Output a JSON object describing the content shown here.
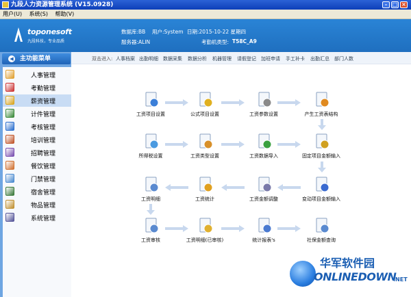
{
  "window": {
    "title": "九段人力资源管理系统 (V15.0928)"
  },
  "menu": [
    "用户(U)",
    "系统(S)",
    "帮助(V)"
  ],
  "header": {
    "logo_text": "toponesoft",
    "logo_slogan": "九段科技，专业品质",
    "database": "数据库:BB",
    "user": "用户:System",
    "date": "日期:2015-10-22 星期四",
    "server": "服务器:ALIN",
    "device_type": "考勤机类型:",
    "device_model": "T58C_A9"
  },
  "sidebar": {
    "title": "主功能菜单",
    "items": [
      {
        "label": "人事管理",
        "icon": "people-icon",
        "color": "#e0a030"
      },
      {
        "label": "考勤管理",
        "icon": "clock-icon",
        "color": "#cc3333"
      },
      {
        "label": "薪资管理",
        "icon": "money-icon",
        "color": "#d9a520"
      },
      {
        "label": "计件管理",
        "icon": "piece-icon",
        "color": "#3a8a3a"
      },
      {
        "label": "考核管理",
        "icon": "check-icon",
        "color": "#2b6fcf"
      },
      {
        "label": "培训管理",
        "icon": "training-icon",
        "color": "#c0552a"
      },
      {
        "label": "招聘管理",
        "icon": "recruit-icon",
        "color": "#7a4fb0"
      },
      {
        "label": "餐饮管理",
        "icon": "dining-icon",
        "color": "#d07030"
      },
      {
        "label": "门禁管理",
        "icon": "door-icon",
        "color": "#4a8ad0"
      },
      {
        "label": "宿舍管理",
        "icon": "dorm-icon",
        "color": "#3a7a3a"
      },
      {
        "label": "物品管理",
        "icon": "goods-icon",
        "color": "#c09030"
      },
      {
        "label": "系统管理",
        "icon": "system-icon",
        "color": "#555599"
      }
    ],
    "active_index": 2
  },
  "shortcuts": {
    "prefix": "双击进入:",
    "items": [
      "人事档案",
      "出勤明细",
      "数据采集",
      "数据分析",
      "机器管理",
      "请假登记",
      "加班申请",
      "手工补卡",
      "出勤汇总",
      "部门人数"
    ]
  },
  "flow": {
    "nodes": [
      {
        "label": "工资项目设置",
        "icon": "abc-book-icon",
        "color": "#3b7fd8"
      },
      {
        "label": "公式项目设置",
        "icon": "pencil-note-icon",
        "color": "#e0b020"
      },
      {
        "label": "工资参数设置",
        "icon": "tools-icon",
        "color": "#8a8a8a"
      },
      {
        "label": "产生工资表结构",
        "icon": "structure-icon",
        "color": "#e08a20"
      },
      {
        "label": "所得税设置",
        "icon": "folder-icon",
        "color": "#4a9ae0"
      },
      {
        "label": "工资类型设置",
        "icon": "person-card-icon",
        "color": "#d8902a"
      },
      {
        "label": "工资数据导入",
        "icon": "disc-import-icon",
        "color": "#3aa040"
      },
      {
        "label": "固定项目金额输入",
        "icon": "pen-doc-icon",
        "color": "#d0a020"
      },
      {
        "label": "工资明细",
        "icon": "doc-search-icon",
        "color": "#5a8ad0"
      },
      {
        "label": "工资统计",
        "icon": "gears-icon",
        "color": "#e0a020"
      },
      {
        "label": "工资金额调整",
        "icon": "doc-edit-icon",
        "color": "#7a7aaa"
      },
      {
        "label": "变动项目金额输入",
        "icon": "brush-icon",
        "color": "#3a6ad0"
      },
      {
        "label": "工资审核",
        "icon": "audit-icon",
        "color": "#5a8ad0"
      },
      {
        "label": "工资明细(已审核)",
        "icon": "folder-search-icon",
        "color": "#e0b030"
      },
      {
        "label": "统计报表's",
        "icon": "report-search-icon",
        "color": "#4a7ad0"
      },
      {
        "label": "社保金额查询",
        "icon": "magnifier-icon",
        "color": "#5a8ad0"
      }
    ]
  },
  "watermark": {
    "cn": "华军软件园",
    "en": "ONLINEDOWN",
    "com": ".NET"
  }
}
